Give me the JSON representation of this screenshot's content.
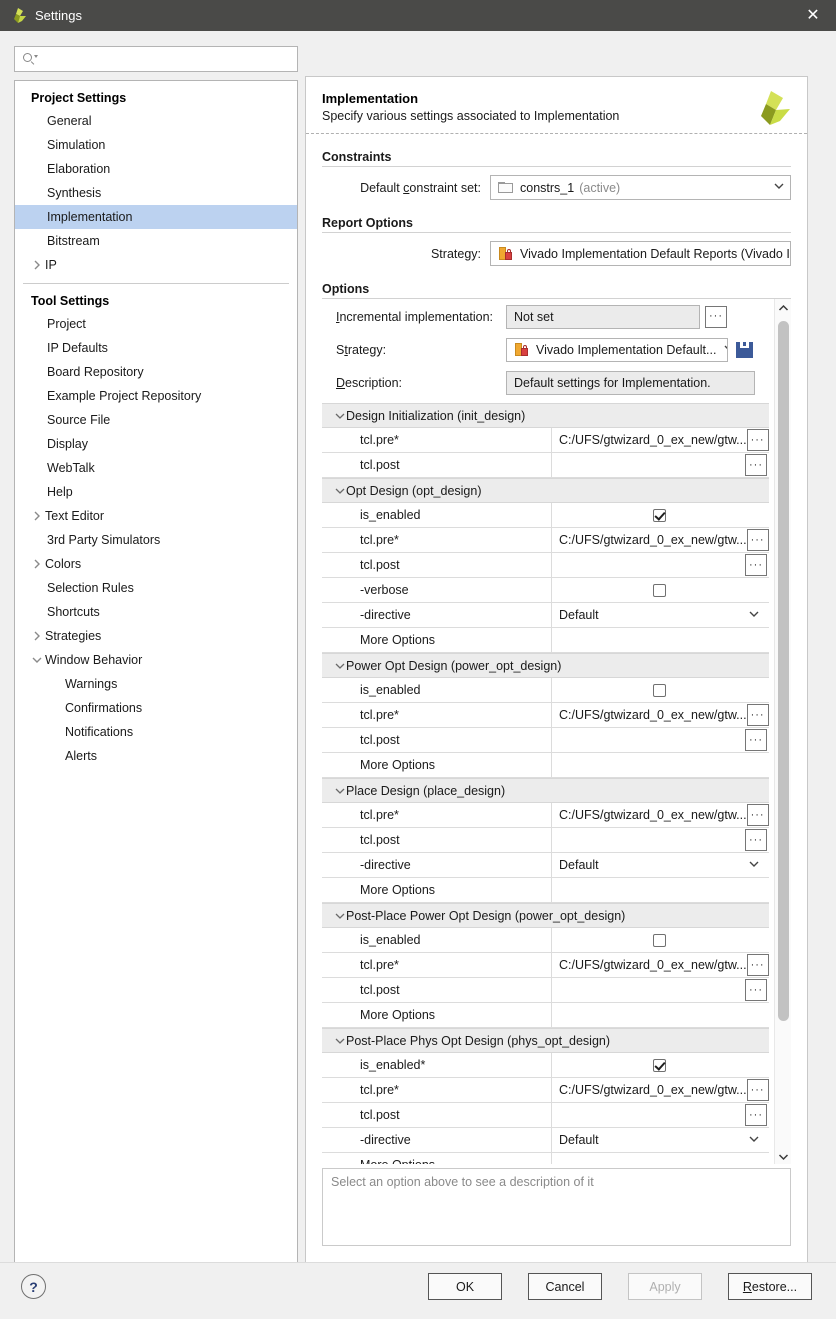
{
  "window": {
    "title": "Settings",
    "app_icon": "xilinx-logo-icon",
    "close_icon": "close-icon"
  },
  "sidebar": {
    "search": {
      "placeholder": "",
      "value": "",
      "icon": "search-icon"
    },
    "groups": [
      {
        "title": "Project Settings",
        "items": [
          {
            "label": "General",
            "indent": 1,
            "expandable": false,
            "selected": false
          },
          {
            "label": "Simulation",
            "indent": 1,
            "expandable": false,
            "selected": false
          },
          {
            "label": "Elaboration",
            "indent": 1,
            "expandable": false,
            "selected": false
          },
          {
            "label": "Synthesis",
            "indent": 1,
            "expandable": false,
            "selected": false
          },
          {
            "label": "Implementation",
            "indent": 1,
            "expandable": false,
            "selected": true
          },
          {
            "label": "Bitstream",
            "indent": 1,
            "expandable": false,
            "selected": false
          },
          {
            "label": "IP",
            "indent": 0,
            "expandable": true,
            "expanded": false,
            "selected": false
          }
        ]
      },
      {
        "title": "Tool Settings",
        "items": [
          {
            "label": "Project",
            "indent": 1,
            "expandable": false,
            "selected": false
          },
          {
            "label": "IP Defaults",
            "indent": 1,
            "expandable": false,
            "selected": false
          },
          {
            "label": "Board Repository",
            "indent": 1,
            "expandable": false,
            "selected": false
          },
          {
            "label": "Example Project Repository",
            "indent": 1,
            "expandable": false,
            "selected": false
          },
          {
            "label": "Source File",
            "indent": 1,
            "expandable": false,
            "selected": false
          },
          {
            "label": "Display",
            "indent": 1,
            "expandable": false,
            "selected": false
          },
          {
            "label": "WebTalk",
            "indent": 1,
            "expandable": false,
            "selected": false
          },
          {
            "label": "Help",
            "indent": 1,
            "expandable": false,
            "selected": false
          },
          {
            "label": "Text Editor",
            "indent": 0,
            "expandable": true,
            "expanded": false,
            "selected": false
          },
          {
            "label": "3rd Party Simulators",
            "indent": 1,
            "expandable": false,
            "selected": false
          },
          {
            "label": "Colors",
            "indent": 0,
            "expandable": true,
            "expanded": false,
            "selected": false
          },
          {
            "label": "Selection Rules",
            "indent": 1,
            "expandable": false,
            "selected": false
          },
          {
            "label": "Shortcuts",
            "indent": 1,
            "expandable": false,
            "selected": false
          },
          {
            "label": "Strategies",
            "indent": 0,
            "expandable": true,
            "expanded": false,
            "selected": false
          },
          {
            "label": "Window Behavior",
            "indent": 0,
            "expandable": true,
            "expanded": true,
            "selected": false
          },
          {
            "label": "Warnings",
            "indent": 2,
            "expandable": false,
            "selected": false
          },
          {
            "label": "Confirmations",
            "indent": 2,
            "expandable": false,
            "selected": false
          },
          {
            "label": "Notifications",
            "indent": 2,
            "expandable": false,
            "selected": false
          },
          {
            "label": "Alerts",
            "indent": 2,
            "expandable": false,
            "selected": false
          }
        ]
      }
    ]
  },
  "panel": {
    "title": "Implementation",
    "subtitle": "Specify various settings associated to Implementation",
    "logo_icon": "xilinx-logo-icon",
    "constraints": {
      "section": "Constraints",
      "constraint_set_label": "Default constraint set:",
      "constraint_set_icon": "folder-icon",
      "constraint_set_value": "constrs_1",
      "constraint_set_suffix": "(active)"
    },
    "report_options": {
      "section": "Report Options",
      "strategy_label": "Strategy:",
      "strategy_icon": "strategy-lock-icon",
      "strategy_value": "Vivado Implementation Default Reports (Vivado Implement..."
    },
    "options": {
      "section": "Options",
      "incremental_label": "Incremental implementation:",
      "incremental_value": "Not set",
      "incremental_browse": "···",
      "strategy_label": "Strategy:",
      "strategy_icon": "strategy-lock-icon",
      "strategy_value": "Vivado Implementation Default...",
      "save_icon": "save-icon",
      "description_label": "Description:",
      "description_value": "Default settings for Implementation.",
      "browse_glyph": "···",
      "groups": [
        {
          "title": "Design Initialization (init_design)",
          "expanded": true,
          "rows": [
            {
              "name": "tcl.pre*",
              "type": "path",
              "value": "C:/UFS/gtwizard_0_ex_new/gtw...",
              "browse": true
            },
            {
              "name": "tcl.post",
              "type": "path",
              "value": "",
              "browse": true
            }
          ]
        },
        {
          "title": "Opt Design (opt_design)",
          "expanded": true,
          "rows": [
            {
              "name": "is_enabled",
              "type": "checkbox",
              "checked": true
            },
            {
              "name": "tcl.pre*",
              "type": "path",
              "value": "C:/UFS/gtwizard_0_ex_new/gtw...",
              "browse": true
            },
            {
              "name": "tcl.post",
              "type": "path",
              "value": "",
              "browse": true
            },
            {
              "name": "-verbose",
              "type": "checkbox",
              "checked": false
            },
            {
              "name": "-directive",
              "type": "dropdown",
              "value": "Default"
            },
            {
              "name": "More Options",
              "type": "text",
              "value": ""
            }
          ]
        },
        {
          "title": "Power Opt Design (power_opt_design)",
          "expanded": true,
          "rows": [
            {
              "name": "is_enabled",
              "type": "checkbox",
              "checked": false
            },
            {
              "name": "tcl.pre*",
              "type": "path",
              "value": "C:/UFS/gtwizard_0_ex_new/gtw...",
              "browse": true
            },
            {
              "name": "tcl.post",
              "type": "path",
              "value": "",
              "browse": true
            },
            {
              "name": "More Options",
              "type": "text",
              "value": ""
            }
          ]
        },
        {
          "title": "Place Design (place_design)",
          "expanded": true,
          "rows": [
            {
              "name": "tcl.pre*",
              "type": "path",
              "value": "C:/UFS/gtwizard_0_ex_new/gtw...",
              "browse": true
            },
            {
              "name": "tcl.post",
              "type": "path",
              "value": "",
              "browse": true
            },
            {
              "name": "-directive",
              "type": "dropdown",
              "value": "Default"
            },
            {
              "name": "More Options",
              "type": "text",
              "value": ""
            }
          ]
        },
        {
          "title": "Post-Place Power Opt Design (power_opt_design)",
          "expanded": true,
          "rows": [
            {
              "name": "is_enabled",
              "type": "checkbox",
              "checked": false
            },
            {
              "name": "tcl.pre*",
              "type": "path",
              "value": "C:/UFS/gtwizard_0_ex_new/gtw...",
              "browse": true
            },
            {
              "name": "tcl.post",
              "type": "path",
              "value": "",
              "browse": true
            },
            {
              "name": "More Options",
              "type": "text",
              "value": ""
            }
          ]
        },
        {
          "title": "Post-Place Phys Opt Design (phys_opt_design)",
          "expanded": true,
          "rows": [
            {
              "name": "is_enabled*",
              "type": "checkbox",
              "checked": true
            },
            {
              "name": "tcl.pre*",
              "type": "path",
              "value": "C:/UFS/gtwizard_0_ex_new/gtw...",
              "browse": true
            },
            {
              "name": "tcl.post",
              "type": "path",
              "value": "",
              "browse": true
            },
            {
              "name": "-directive",
              "type": "dropdown",
              "value": "Default"
            },
            {
              "name": "More Options",
              "type": "text",
              "value": ""
            }
          ]
        }
      ]
    },
    "description_hint": "Select an option above to see a description of it"
  },
  "footer": {
    "help_label": "?",
    "ok_label": "OK",
    "cancel_label": "Cancel",
    "apply_label": "Apply",
    "apply_disabled": true,
    "restore_label": "Restore..."
  },
  "colors": {
    "titlebar_bg": "#4a4a48",
    "selection_bg": "#bcd2f0",
    "group_row_bg": "#ececec",
    "accent_logo_dark": "#7f8b1c",
    "accent_logo_light": "#d4e157",
    "save_icon": "#3c5a99",
    "help_text": "#2a3f75"
  }
}
